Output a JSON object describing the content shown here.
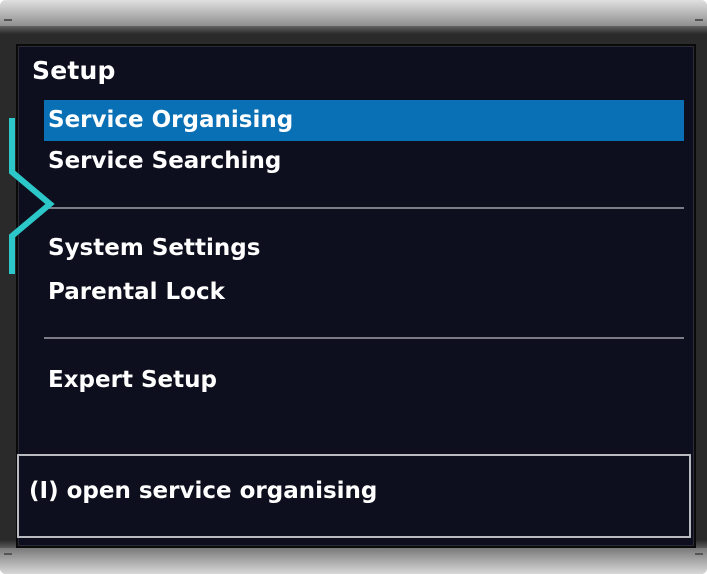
{
  "menu": {
    "title": "Setup",
    "items": [
      {
        "label": "Service Organising",
        "selected": true
      },
      {
        "label": "Service Searching",
        "selected": false
      },
      {
        "label": "System Settings",
        "selected": false
      },
      {
        "label": "Parental Lock",
        "selected": false
      },
      {
        "label": "Expert Setup",
        "selected": false
      }
    ]
  },
  "status": {
    "hint": "(I) open service organising"
  },
  "colors": {
    "background": "#0e0f1e",
    "highlight": "#0a70b5",
    "pointer": "#2cc7c9",
    "text": "#ffffff"
  },
  "icons": {
    "pointer": "callout-arrow-icon"
  }
}
